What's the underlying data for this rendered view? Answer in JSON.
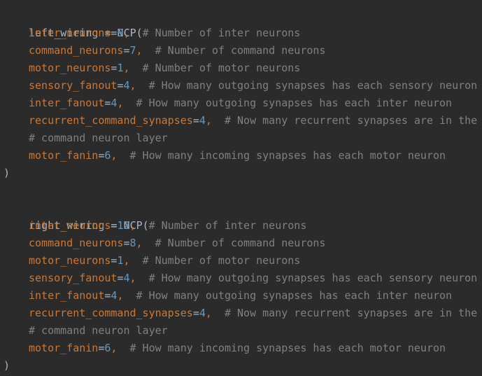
{
  "blocks": [
    {
      "header": "left_wiring = NCP(",
      "params": [
        {
          "name": "inter_neurons",
          "value": "9",
          "comment": "# Number of inter neurons"
        },
        {
          "name": "command_neurons",
          "value": "7",
          "comment": "# Number of command neurons"
        },
        {
          "name": "motor_neurons",
          "value": "1",
          "comment": "# Number of motor neurons"
        },
        {
          "name": "sensory_fanout",
          "value": "4",
          "comment": "# How many outgoing synapses has each sensory neuron"
        },
        {
          "name": "inter_fanout",
          "value": "4",
          "comment": "# How many outgoing synapses has each inter neuron"
        },
        {
          "name": "recurrent_command_synapses",
          "value": "4",
          "comment": "# Now many recurrent synapses are in the"
        },
        {
          "name": "motor_fanin",
          "value": "6",
          "comment": "# How many incoming synapses has each motor neuron"
        }
      ],
      "continuation": "# command neuron layer",
      "closer": ")"
    },
    {
      "header": "right_wiring = NCP(",
      "params": [
        {
          "name": "inter_neurons",
          "value": "12",
          "comment": "# Number of inter neurons"
        },
        {
          "name": "command_neurons",
          "value": "8",
          "comment": "# Number of command neurons"
        },
        {
          "name": "motor_neurons",
          "value": "1",
          "comment": "# Number of motor neurons"
        },
        {
          "name": "sensory_fanout",
          "value": "4",
          "comment": "# How many outgoing synapses has each sensory neuron"
        },
        {
          "name": "inter_fanout",
          "value": "4",
          "comment": "# How many outgoing synapses has each inter neuron"
        },
        {
          "name": "recurrent_command_synapses",
          "value": "4",
          "comment": "# Now many recurrent synapses are in the"
        },
        {
          "name": "motor_fanin",
          "value": "6",
          "comment": "# How many incoming synapses has each motor neuron"
        }
      ],
      "continuation": "# command neuron layer",
      "closer": ")"
    }
  ],
  "syntax_colors": {
    "background": "#2b2b2b",
    "parameter": "#cc7832",
    "number": "#6897bb",
    "comment": "#808080",
    "plain": "#a9b7c6"
  }
}
